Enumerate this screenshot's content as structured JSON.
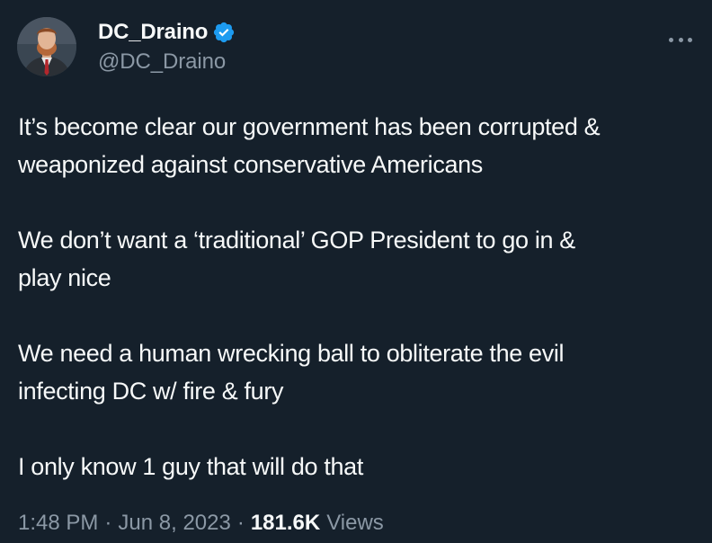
{
  "author": {
    "display_name": "DC_Draino",
    "handle": "@DC_Draino",
    "verified": true,
    "verified_color": "#1d9bf0",
    "avatar_icon": "profile-photo"
  },
  "menu": {
    "more_icon": "more-horizontal-icon"
  },
  "tweet": {
    "paragraphs": [
      "It’s become clear our government has been corrupted &\nweaponized against conservative Americans",
      "We don’t want a ‘traditional’ GOP President to go in &\nplay nice",
      "We need a human wrecking ball to obliterate the evil\ninfecting DC w/ fire & fury",
      "I only know 1 guy that will do that"
    ]
  },
  "meta": {
    "time": "1:48 PM",
    "separator": "·",
    "date": "Jun 8, 2023",
    "views_count": "181.6K",
    "views_label": "Views"
  },
  "colors": {
    "background": "#15202b",
    "text_primary": "#f7f9f9",
    "text_secondary": "#8b98a5",
    "accent": "#1d9bf0"
  }
}
